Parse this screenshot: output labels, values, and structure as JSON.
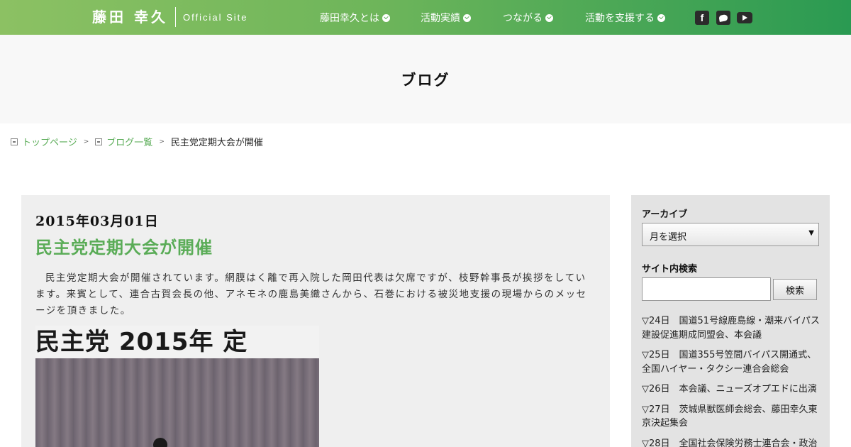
{
  "header": {
    "logo_name": "藤田 幸久",
    "logo_sub": "Official Site",
    "nav": [
      "藤田幸久とは",
      "活動実績",
      "つながる",
      "活動を支援する"
    ],
    "social": {
      "facebook": "f"
    }
  },
  "page_title": "ブログ",
  "breadcrumb": {
    "home": "トップページ",
    "blog": "ブログ一覧",
    "current": "民主党定期大会が開催",
    "separator": ">"
  },
  "post": {
    "date": "2015年03月01日",
    "title": "民主党定期大会が開催",
    "body": "民主党定期大会が開催されています。網膜はく離で再入院した岡田代表は欠席ですが、枝野幹事長が挨拶をしています。来賓として、連合古賀会長の他、アネモネの鹿島美織さんから、石巻における被災地支援の現場からのメッセージを頂きました。",
    "photo_banner": "民主党 2015年 定"
  },
  "sidebar": {
    "archive_heading": "アーカイブ",
    "archive_select": "月を選択",
    "search_heading": "サイト内検索",
    "search_button": "検索",
    "items": [
      "▽24日　国道51号線鹿島線・潮来バイパス建設促進期成同盟会、本会議",
      "▽25日　国道355号笠間バイパス開通式、全国ハイヤー・タクシー連合会総会",
      "▽26日　本会議、ニューズオプエドに出演",
      "▽27日　茨城県獣医師会総会、藤田幸久東京決起集会",
      "▽28日　全国社会保険労務士連合会・政治"
    ]
  },
  "colors": {
    "accent": "#5aac57",
    "header_start": "#8cc163",
    "header_end": "#2a9a52"
  }
}
